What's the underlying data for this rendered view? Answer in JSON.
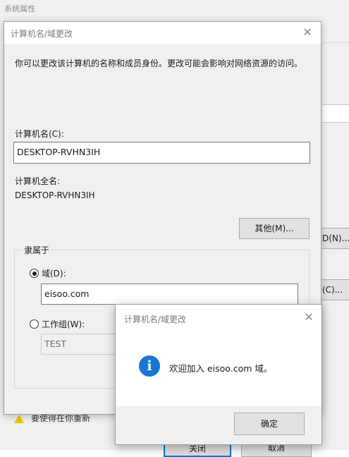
{
  "background_window": {
    "title": "系统属性",
    "button_other_partial": "D(N)...",
    "button_change_partial": "(C)...",
    "warning_text_partial": "要使得在你重新",
    "button_close": "关闭",
    "button_cancel": "取消"
  },
  "dialog": {
    "title": "计算机名/域更改",
    "description": "你可以更改该计算机的名称和成员身份。更改可能会影响对网络资源的访问。",
    "computer_name_label": "计算机名(C):",
    "computer_name_value": "DESKTOP-RVHN3IH",
    "full_name_label": "计算机全名:",
    "full_name_value": "DESKTOP-RVHN3IH",
    "more_button": "其他(M)...",
    "member_of_label": "隶属于",
    "domain_radio_label": "域(D):",
    "domain_value": "eisoo.com",
    "workgroup_radio_label": "工作组(W):",
    "workgroup_value": "TEST"
  },
  "message_box": {
    "title": "计算机名/域更改",
    "icon": "info-icon",
    "message": "欢迎加入 eisoo.com 域。",
    "ok_button": "确定"
  },
  "colors": {
    "info_icon": "#1976d2",
    "focus_border": "#0078d7",
    "warning_icon": "#f2c200"
  }
}
